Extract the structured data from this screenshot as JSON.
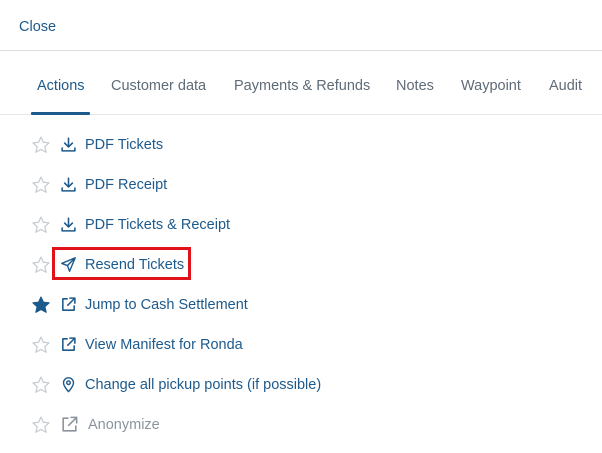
{
  "header": {
    "close_label": "Close"
  },
  "tabs": [
    {
      "label": "Actions",
      "active": true
    },
    {
      "label": "Customer data"
    },
    {
      "label": "Payments & Refunds"
    },
    {
      "label": "Notes"
    },
    {
      "label": "Waypoint"
    },
    {
      "label": "Audit"
    }
  ],
  "actions": [
    {
      "label": "PDF Tickets",
      "icon": "download-icon",
      "favorite": false
    },
    {
      "label": "PDF Receipt",
      "icon": "download-icon",
      "favorite": false
    },
    {
      "label": "PDF Tickets & Receipt",
      "icon": "download-icon",
      "favorite": false
    },
    {
      "label": "Resend Tickets",
      "icon": "send-icon",
      "favorite": false,
      "highlighted": true
    },
    {
      "label": "Jump to Cash Settlement",
      "icon": "external-link-icon",
      "favorite": true
    },
    {
      "label": "View Manifest for Ronda",
      "icon": "external-link-icon",
      "favorite": false
    },
    {
      "label": "Change all pickup points (if possible)",
      "icon": "map-pin-icon",
      "favorite": false
    },
    {
      "label": "Anonymize",
      "icon": "external-link-icon",
      "favorite": false,
      "disabled": true
    }
  ],
  "colors": {
    "accent": "#1d5a8c",
    "tab_inactive": "#5f6b77",
    "star_outline": "#c7ccd1",
    "highlight": "#e0121a",
    "disabled": "#8a939c"
  }
}
